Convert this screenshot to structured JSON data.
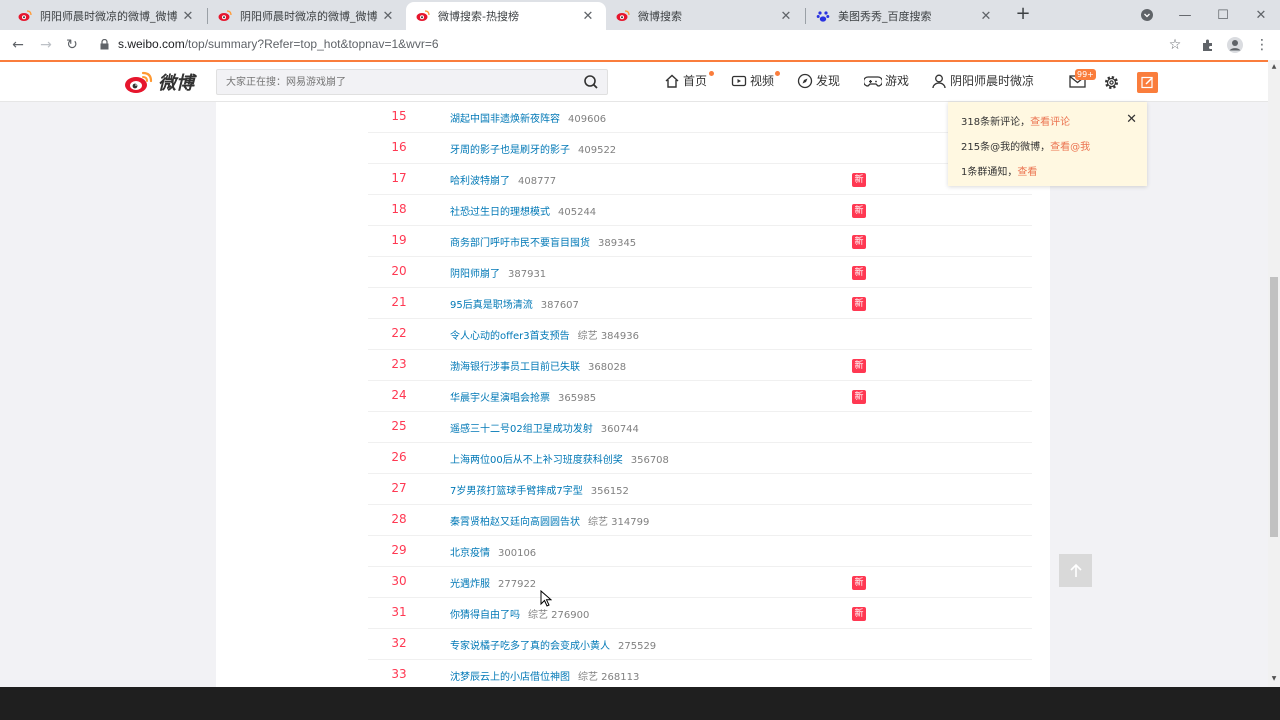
{
  "browser": {
    "tabs": [
      {
        "title": "阴阳师晨时微凉的微博_微博"
      },
      {
        "title": "阴阳师晨时微凉的微博_微博"
      },
      {
        "title": "微博搜索-热搜榜"
      },
      {
        "title": "微博搜索"
      },
      {
        "title": "美图秀秀_百度搜索"
      }
    ],
    "new_tab": "+",
    "url_host": "s.weibo.com",
    "url_rest": "/top/summary?Refer=top_hot&topnav=1&wvr=6",
    "back": "←",
    "forward": "→",
    "reload": "↻",
    "star": "☆",
    "extensions": "✦",
    "menu": "⋮",
    "minimize": "—",
    "maximize": "☐",
    "close": "✕",
    "tab_close": "✕",
    "profile_dropdown": "▾"
  },
  "weibo": {
    "logo_text": "微博",
    "search_placeholder": "大家正在搜：网易游戏崩了",
    "nav": {
      "home": "首页",
      "video": "视频",
      "discover": "发现",
      "game": "游戏",
      "user": "阴阳师晨时微凉"
    },
    "msg_badge": "99+",
    "new_badge": "新",
    "hot_list": [
      {
        "rank": "15",
        "title": "湖起中国非遗焕新夜阵容",
        "meta": "409606",
        "is_new": false
      },
      {
        "rank": "16",
        "title": "牙周的影子也是刷牙的影子",
        "meta": "409522",
        "is_new": false
      },
      {
        "rank": "17",
        "title": "哈利波特崩了",
        "meta": "408777",
        "is_new": true
      },
      {
        "rank": "18",
        "title": "社恐过生日的理想模式",
        "meta": "405244",
        "is_new": true
      },
      {
        "rank": "19",
        "title": "商务部门呼吁市民不要盲目囤货",
        "meta": "389345",
        "is_new": true
      },
      {
        "rank": "20",
        "title": "阴阳师崩了",
        "meta": "387931",
        "is_new": true
      },
      {
        "rank": "21",
        "title": "95后真是职场清流",
        "meta": "387607",
        "is_new": true
      },
      {
        "rank": "22",
        "title": "令人心动的offer3首支预告",
        "meta": "综艺 384936",
        "is_new": false
      },
      {
        "rank": "23",
        "title": "渤海银行涉事员工目前已失联",
        "meta": "368028",
        "is_new": true
      },
      {
        "rank": "24",
        "title": "华晨宇火星演唱会抢票",
        "meta": "365985",
        "is_new": true
      },
      {
        "rank": "25",
        "title": "遥感三十二号02组卫星成功发射",
        "meta": "360744",
        "is_new": false
      },
      {
        "rank": "26",
        "title": "上海两位00后从不上补习班度获科创奖",
        "meta": "356708",
        "is_new": false
      },
      {
        "rank": "27",
        "title": "7岁男孩打篮球手臂摔成7字型",
        "meta": "356152",
        "is_new": false
      },
      {
        "rank": "28",
        "title": "秦霄贤柏赵又廷向高圆圆告状",
        "meta": "综艺 314799",
        "is_new": false
      },
      {
        "rank": "29",
        "title": "北京疫情",
        "meta": "300106",
        "is_new": false
      },
      {
        "rank": "30",
        "title": "光遇炸服",
        "meta": "277922",
        "is_new": true
      },
      {
        "rank": "31",
        "title": "你猜得自由了吗",
        "meta": "综艺 276900",
        "is_new": true
      },
      {
        "rank": "32",
        "title": "专家说橘子吃多了真的会变成小黄人",
        "meta": "275529",
        "is_new": false
      },
      {
        "rank": "33",
        "title": "沈梦辰云上的小店借位神图",
        "meta": "综艺 268113",
        "is_new": false
      }
    ],
    "notifications": {
      "line1_text": "318条新评论，",
      "line1_link": "查看评论",
      "line2_text": "215条@我的微博，",
      "line2_link": "查看@我",
      "line3_text": "1条群通知，",
      "line3_link": "查看",
      "close": "✕"
    }
  },
  "colors": {
    "accent": "#fa7d3c",
    "link": "#0078b6",
    "rank_red": "#ff3852",
    "new_badge": "#ff3852"
  }
}
